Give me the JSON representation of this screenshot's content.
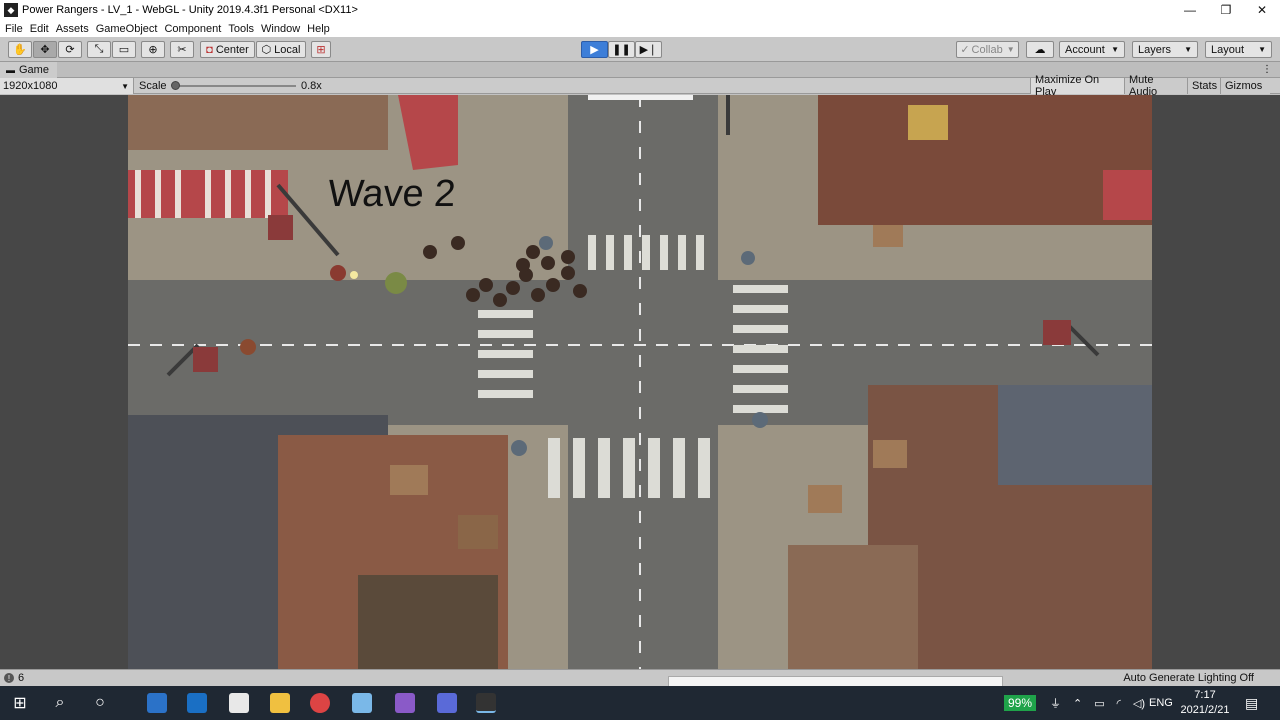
{
  "window": {
    "title": "Power Rangers - LV_1 - WebGL - Unity 2019.4.3f1 Personal <DX11>",
    "minimize": "—",
    "maximize": "❐",
    "close": "✕"
  },
  "menu": [
    "File",
    "Edit",
    "Assets",
    "GameObject",
    "Component",
    "Tools",
    "Window",
    "Help"
  ],
  "toolbar": {
    "pivot_label": "Center",
    "space_label": "Local",
    "collab_label": "Collab",
    "account_label": "Account",
    "layers_label": "Layers",
    "layout_label": "Layout"
  },
  "panel": {
    "tab_label": "Game",
    "resolution": "1920x1080",
    "scale_label": "Scale",
    "scale_value": "0.8x",
    "maximize_on_play": "Maximize On Play",
    "mute_audio": "Mute Audio",
    "stats": "Stats",
    "gizmos": "Gizmos"
  },
  "game": {
    "wave_text": "Wave 2"
  },
  "status": {
    "count": "6",
    "lighting": "Auto Generate Lighting Off"
  },
  "taskbar": {
    "battery": "99%",
    "language": "ENG",
    "time": "7:17",
    "date": "2021/2/21"
  },
  "colors": {
    "play_blue": "#3d7ed8",
    "taskbar": "#1f2833",
    "battery_green": "#1fa34a"
  }
}
